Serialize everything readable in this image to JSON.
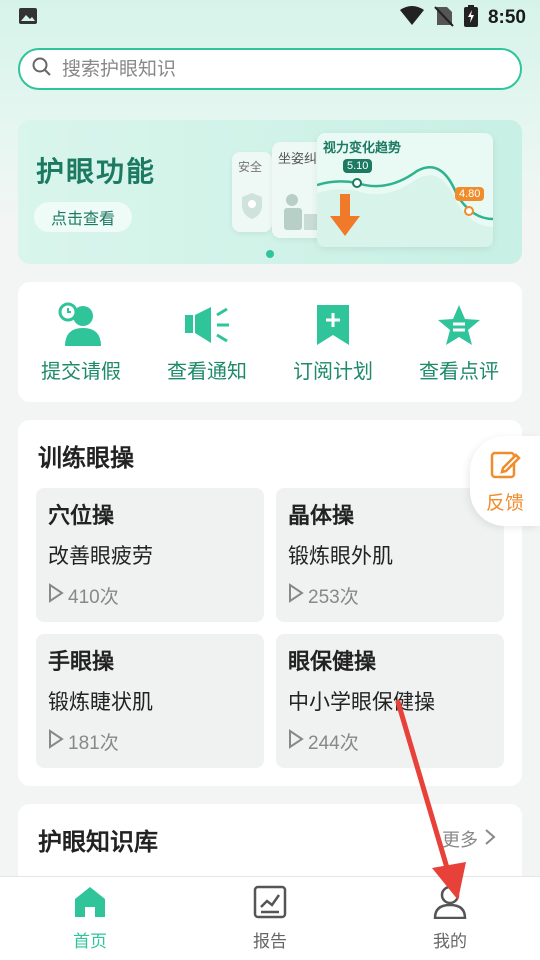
{
  "status_bar": {
    "time": "8:50"
  },
  "search": {
    "placeholder": "搜索护眼知识"
  },
  "banner": {
    "title": "护眼功能",
    "button_label": "点击查看",
    "card1_label": "安全",
    "card2_label": "坐姿纠",
    "trend_title": "视力变化趋势",
    "trend_value_start": "5.10",
    "trend_value_end": "4.80"
  },
  "quick_actions": [
    {
      "label": "提交请假",
      "icon": "user-clock-icon"
    },
    {
      "label": "查看通知",
      "icon": "speaker-icon"
    },
    {
      "label": "订阅计划",
      "icon": "bookmark-plus-icon"
    },
    {
      "label": "查看点评",
      "icon": "star-icon"
    }
  ],
  "training": {
    "title": "训练眼操",
    "items": [
      {
        "name": "穴位操",
        "desc": "改善眼疲劳",
        "count": "410次"
      },
      {
        "name": "晶体操",
        "desc": "锻炼眼外肌",
        "count": "253次"
      },
      {
        "name": "手眼操",
        "desc": "锻炼睫状肌",
        "count": "181次"
      },
      {
        "name": "眼保健操",
        "desc": "中小学眼保健操",
        "count": "244次"
      }
    ]
  },
  "feedback": {
    "label": "反馈"
  },
  "knowledge": {
    "title": "护眼知识库",
    "more": "更多"
  },
  "bottom_nav": [
    {
      "label": "首页",
      "active": true
    },
    {
      "label": "报告",
      "active": false
    },
    {
      "label": "我的",
      "active": false
    }
  ],
  "colors": {
    "accent": "#2fc49a",
    "orange": "#f08c2a",
    "annotation": "#e8413a"
  }
}
